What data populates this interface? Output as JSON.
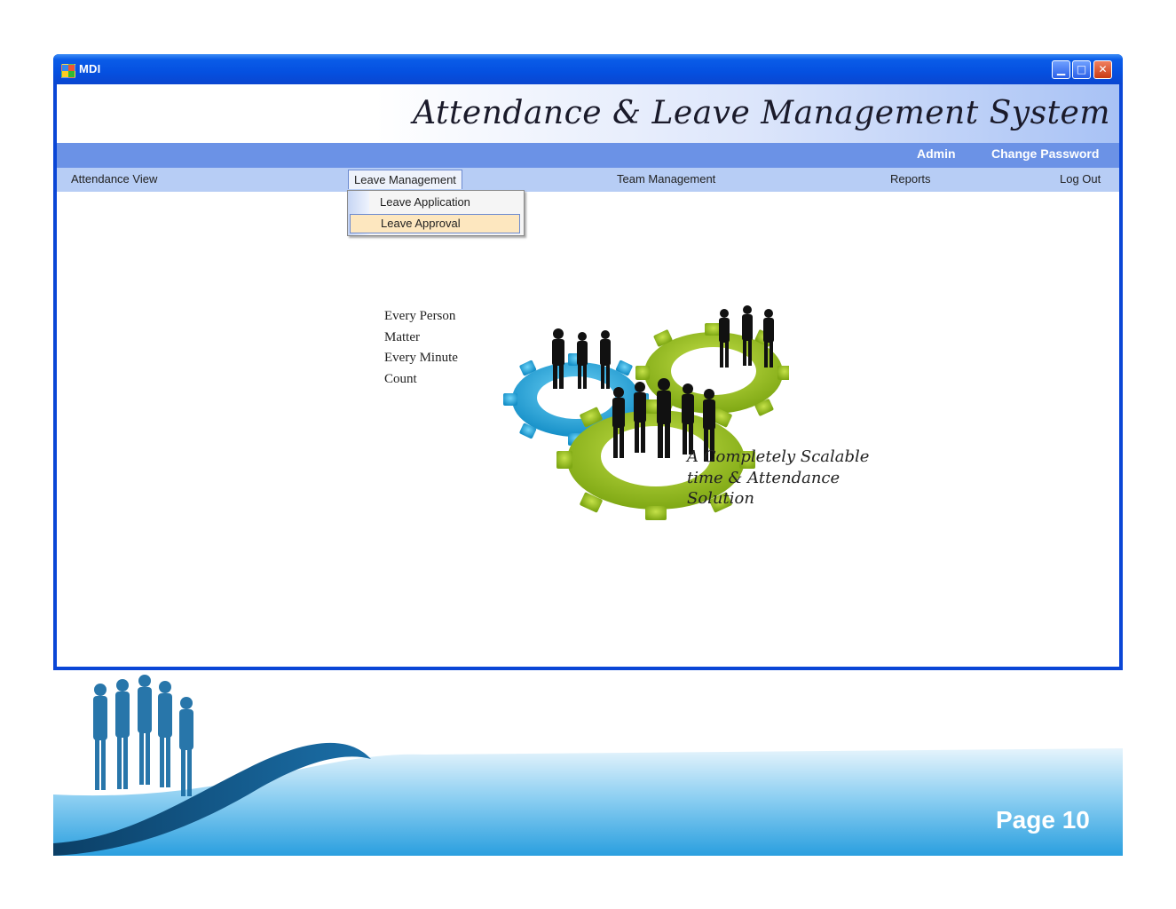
{
  "window": {
    "title": "MDI",
    "controls": {
      "minimize_icon": "minimize-icon",
      "maximize_icon": "maximize-icon",
      "close_icon": "close-icon"
    }
  },
  "app": {
    "title": "Attendance & Leave Management System",
    "admin_label": "Admin",
    "change_password": "Change Password"
  },
  "menu": {
    "items": [
      "Attendance View",
      "Leave Management",
      "Team Management",
      "Reports",
      "Log Out"
    ],
    "open_menu": "Leave Management",
    "dropdown": [
      "Leave Application",
      "Leave Approval"
    ],
    "highlighted_item": "Leave Approval"
  },
  "graphic": {
    "slogan_left": [
      "Every Person",
      "Matter",
      "Every Minute",
      "Count"
    ],
    "slogan_right": [
      "A Completely Scalable",
      "time & Attendance",
      "Solution"
    ]
  },
  "slide": {
    "page_label": "Page 10"
  },
  "colors": {
    "titlebar": "#0a5ce8",
    "admin_bar": "#6b92e6",
    "menubar": "#b7cdf5",
    "highlight": "#fde7bf",
    "gear_blue": "#2ab0e6",
    "gear_green": "#9cc421"
  }
}
